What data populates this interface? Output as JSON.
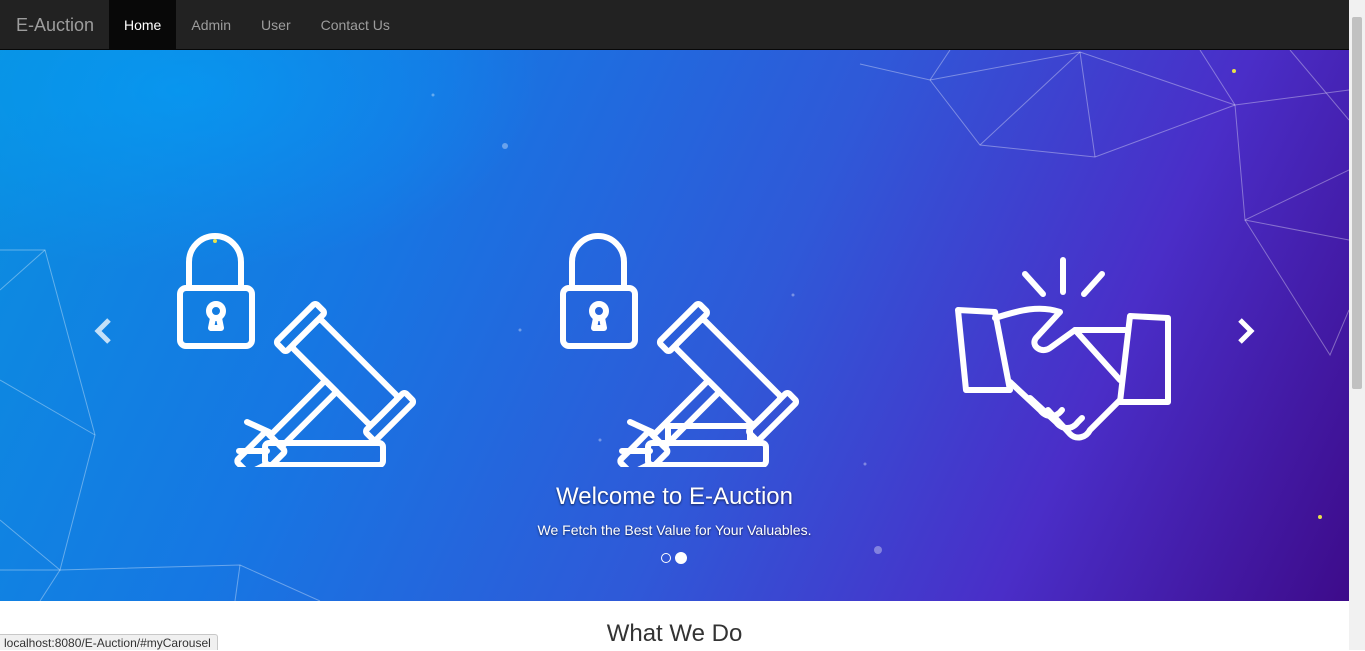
{
  "navbar": {
    "brand": "E-Auction",
    "items": [
      {
        "label": "Home",
        "active": true
      },
      {
        "label": "Admin",
        "active": false
      },
      {
        "label": "User",
        "active": false
      },
      {
        "label": "Contact Us",
        "active": false
      }
    ]
  },
  "carousel": {
    "caption_title": "Welcome to E-Auction",
    "caption_subtitle": "We Fetch the Best Value for Your Valuables.",
    "slide_count": 2,
    "active_slide": 2,
    "prev_icon": "chevron-left-icon",
    "next_icon": "chevron-right-icon",
    "illustrations": [
      "lock-gavel-icon",
      "lock-gavel-icon",
      "handshake-icon"
    ],
    "colors": {
      "start": "#0a8fe0",
      "mid": "#2f59d8",
      "end": "#3d0b8a"
    }
  },
  "section": {
    "title": "What We Do"
  },
  "status_bar": {
    "url": "localhost:8080/E-Auction/#myCarousel"
  }
}
